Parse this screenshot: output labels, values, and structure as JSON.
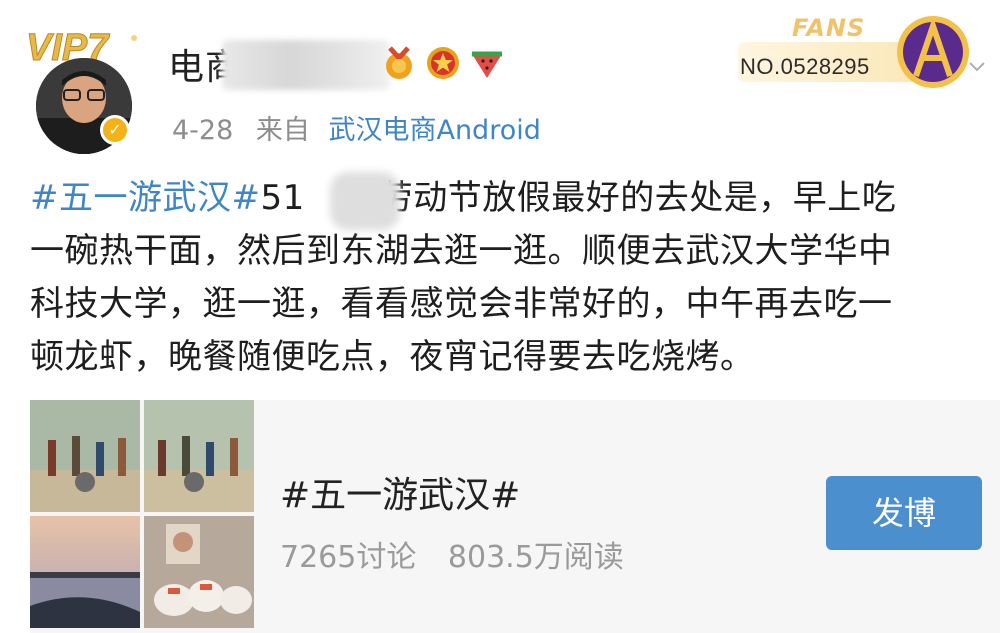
{
  "header": {
    "vip_label": "VIP7",
    "username": "电商",
    "date": "4-28",
    "from_label": "来自",
    "source": "武汉电商Android",
    "fans_label": "FANS",
    "fans_number": "NO.0528295"
  },
  "post": {
    "hashtag": "#五一游武汉#",
    "text_lines": [
      "51",
      "劳动节放假最好的去处是，早上吃",
      "一碗热干面，然后到东湖去逛一逛。顺便去武汉大学华中",
      "科技大学，逛一逛，看看感觉会非常好的，中午再去吃一",
      "顿龙虾，晚餐随便吃点，夜宵记得要去吃烧烤。"
    ]
  },
  "topic_card": {
    "title": "#五一游武汉#",
    "discussions": "7265讨论",
    "reads": "803.5万阅读",
    "post_button": "发博"
  },
  "colors": {
    "link": "#3e86c8",
    "button": "#4c8fcf",
    "meta_text": "#8d8d8d",
    "card_bg": "#f6f6f6",
    "gold": "#f3b11a"
  },
  "icons": [
    "vip-badge-icon",
    "verified-icon",
    "medal-icon",
    "star-medal-icon",
    "watermelon-icon",
    "fans-badge-icon",
    "chevron-down-icon"
  ]
}
